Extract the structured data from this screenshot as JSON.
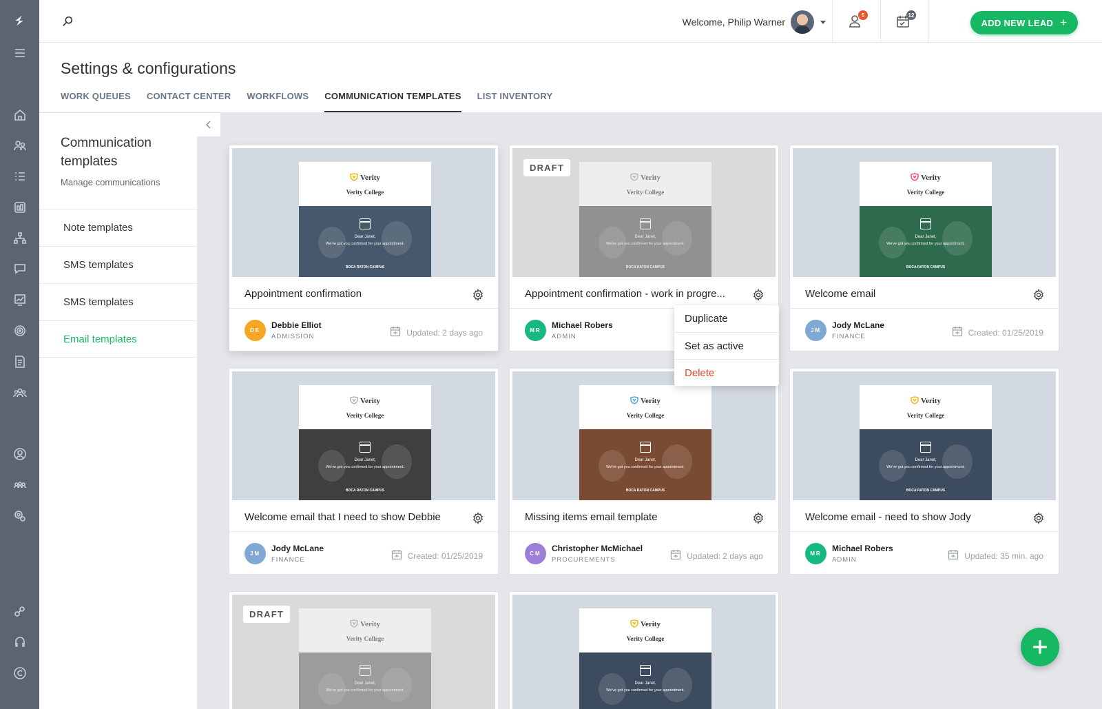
{
  "topbar": {
    "welcome": "Welcome, Philip Warner",
    "notifications_count": "5",
    "tasks_count": "12",
    "add_lead_label": "ADD NEW LEAD",
    "add_lead_plus": "+",
    "colors": {
      "accent": "#17b864",
      "badge_red": "#f0532a",
      "badge_dark": "#5b6570"
    }
  },
  "header": {
    "title": "Settings & configurations",
    "tabs": [
      {
        "label": "WORK QUEUES"
      },
      {
        "label": "CONTACT CENTER"
      },
      {
        "label": "WORKFLOWS"
      },
      {
        "label": "COMMUNICATION TEMPLATES"
      },
      {
        "label": "LIST INVENTORY"
      }
    ]
  },
  "sidebar": {
    "title": "Communication templates",
    "subtitle": "Manage communications",
    "items": [
      {
        "label": "Note templates"
      },
      {
        "label": "SMS templates"
      },
      {
        "label": "SMS templates"
      },
      {
        "label": "Email templates"
      }
    ]
  },
  "email_preview": {
    "brand": "Verity",
    "college": "Verity College",
    "greeting": "Dear Janet,",
    "message": "We've got you confirmed for your appointment.",
    "campus": "BOCA RATON CAMPUS"
  },
  "draft_label": "DRAFT",
  "cards": [
    {
      "title": "Appointment confirmation",
      "initials": "DE",
      "user": "Debbie Elliot",
      "role": "ADMISSION",
      "date": "Updated: 2 days ago",
      "avatar_color": "#f5a623",
      "hero_color": "#46586b",
      "shield_color": "#f0b400"
    },
    {
      "title": "Appointment confirmation - work in progre...",
      "initials": "MR",
      "user": "Michael Robers",
      "role": "ADMIN",
      "date": "",
      "avatar_color": "#17b882",
      "hero_color": "#46586b",
      "shield_color": "#999999"
    },
    {
      "title": "Welcome email",
      "initials": "JM",
      "user": "Jody McLane",
      "role": "FINANCE",
      "date": "Created: 01/25/2019",
      "avatar_color": "#7fa8d4",
      "hero_color": "#2e6a4e",
      "shield_color": "#e5415c"
    },
    {
      "title": "Welcome email that I need to show Debbie",
      "initials": "JM",
      "user": "Jody McLane",
      "role": "FINANCE",
      "date": "Created: 01/25/2019",
      "avatar_color": "#7fa8d4",
      "hero_color": "#3f3f3f",
      "shield_color": "#aaaaaa"
    },
    {
      "title": "Missing items email template",
      "initials": "CM",
      "user": "Christopher McMichael",
      "role": "PROCUREMENTS",
      "date": "Updated: 2 days ago",
      "avatar_color": "#9b7fd8",
      "hero_color": "#7a4b33",
      "shield_color": "#3aa6d6"
    },
    {
      "title": "Welcome email - need to show Jody",
      "initials": "MR",
      "user": "Michael Robers",
      "role": "ADMIN",
      "date": "Updated: 35 min. ago",
      "avatar_color": "#17b882",
      "hero_color": "#3c4c5e",
      "shield_color": "#f0b400"
    },
    {
      "title": "",
      "hero_color": "#6a6a6a",
      "shield_color": "#999999"
    },
    {
      "title": "",
      "hero_color": "#3c4c5e",
      "shield_color": "#f0b400"
    }
  ],
  "context_menu": [
    {
      "label": "Duplicate"
    },
    {
      "label": "Set as active"
    },
    {
      "label": "Delete"
    }
  ]
}
